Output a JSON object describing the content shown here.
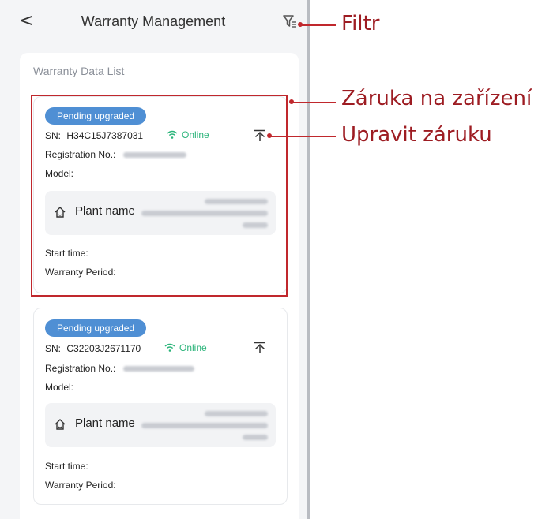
{
  "header": {
    "back_icon": "chevron-left-icon",
    "title": "Warranty Management",
    "filter_icon": "filter-icon"
  },
  "panel": {
    "title": "Warranty Data List"
  },
  "cards": [
    {
      "status": "Pending upgraded",
      "sn_label": "SN:",
      "sn_value": "H34C15J7387031",
      "online": "Online",
      "registration_label": "Registration No.:",
      "model_label": "Model:",
      "plant_label": "Plant name",
      "start_time_label": "Start time:",
      "warranty_period_label": "Warranty Period:"
    },
    {
      "status": "Pending upgraded",
      "sn_label": "SN:",
      "sn_value": "C32203J2671170",
      "online": "Online",
      "registration_label": "Registration No.:",
      "model_label": "Model:",
      "plant_label": "Plant name",
      "start_time_label": "Start time:",
      "warranty_period_label": "Warranty Period:"
    }
  ],
  "annotations": {
    "filter": "Filtr",
    "device_warranty": "Záruka na zařízení",
    "edit_warranty": "Upravit záruku"
  },
  "colors": {
    "badge": "#4f8fd4",
    "online": "#2bb47a",
    "annotation": "#9d1c22"
  }
}
